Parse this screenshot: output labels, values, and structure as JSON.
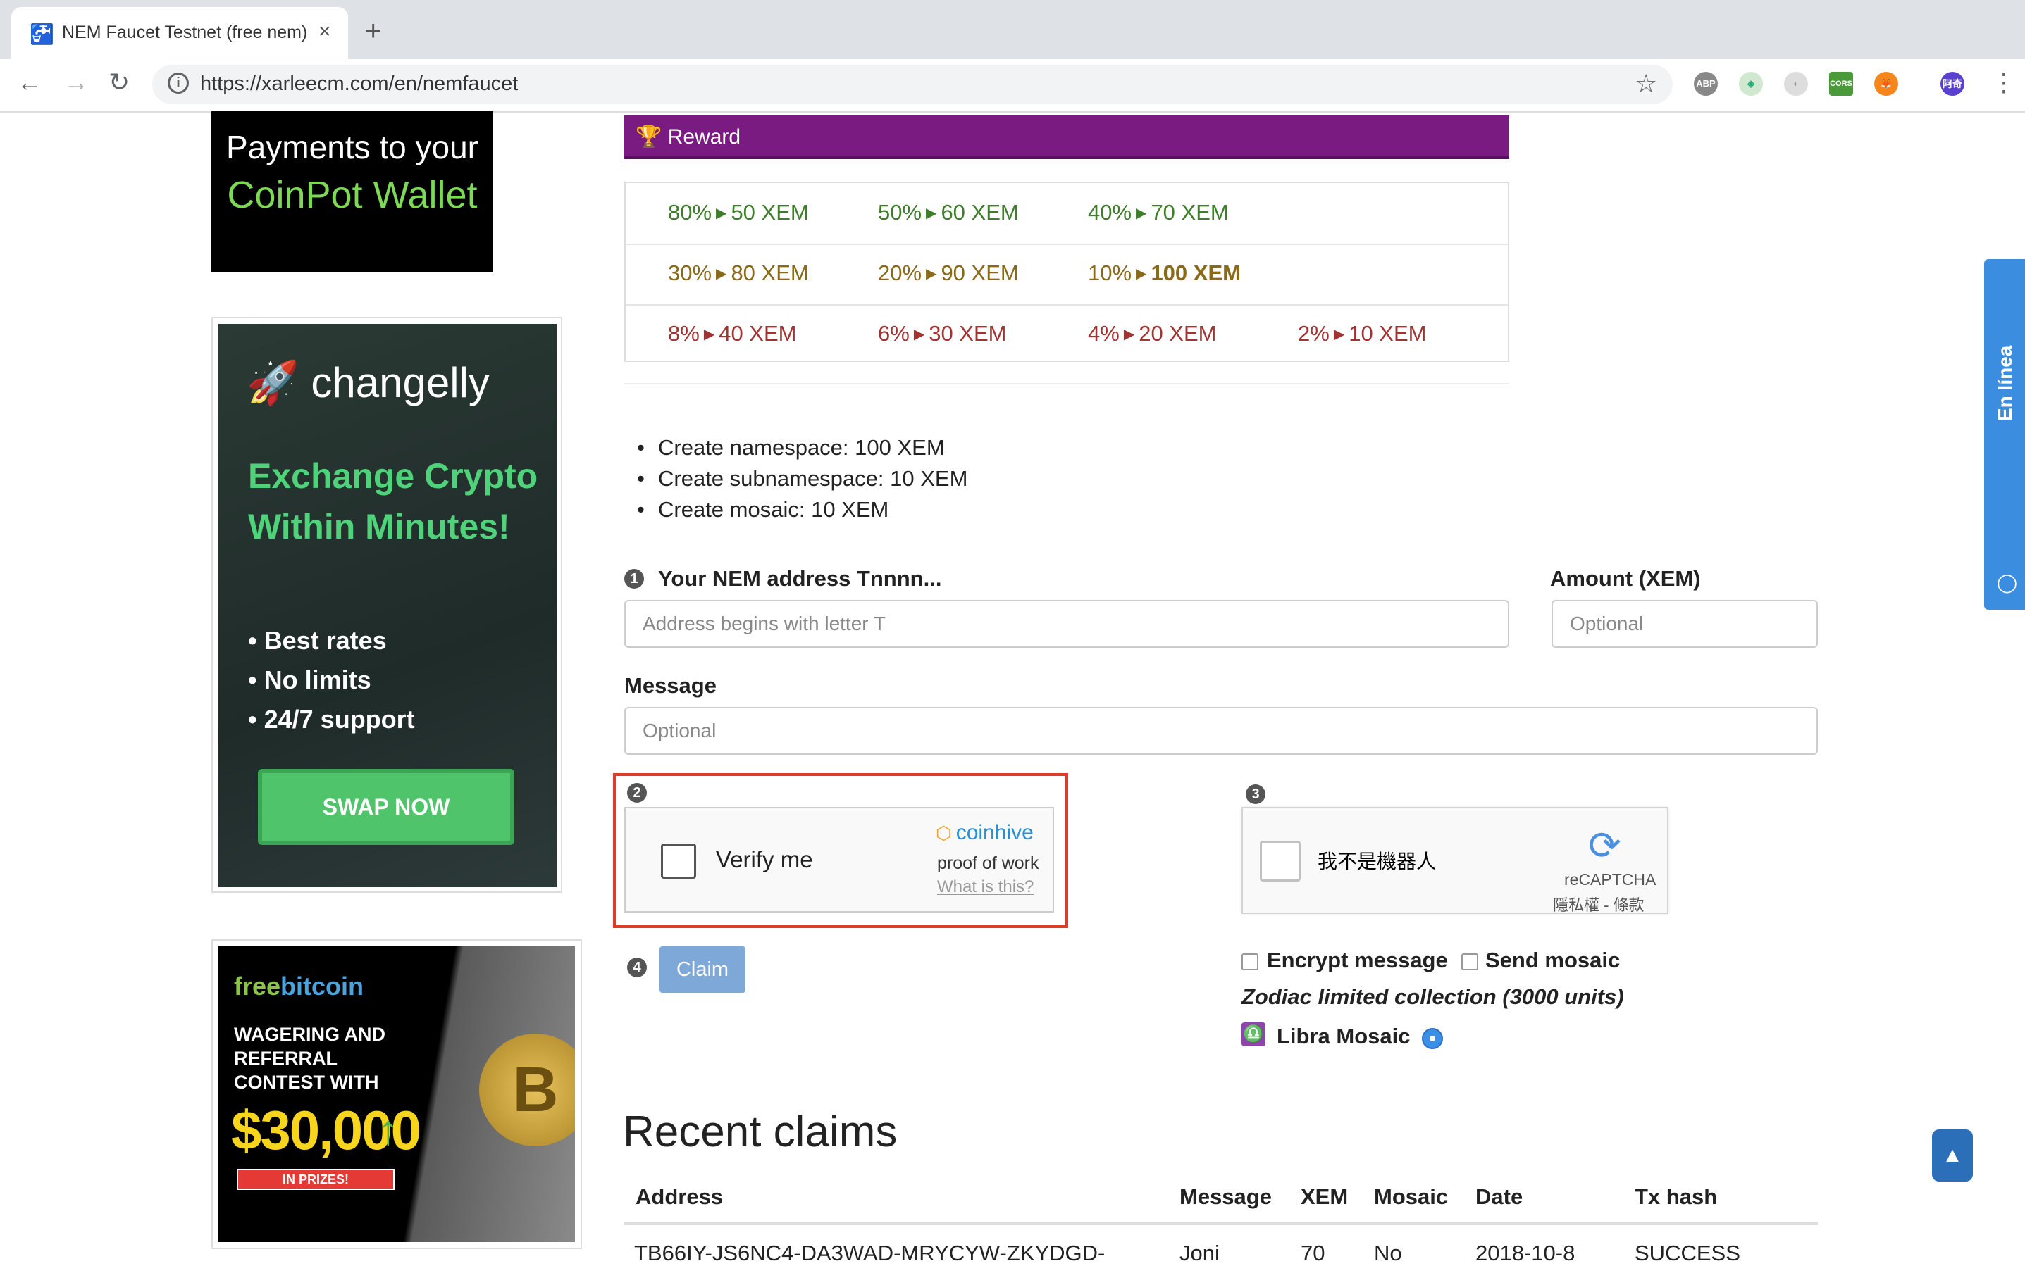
{
  "browser": {
    "tab_title": "NEM Faucet Testnet (free nem)",
    "tab_close": "×",
    "new_tab": "+",
    "url": "https://xarleecm.com/en/nemfaucet",
    "extensions": [
      "ABP",
      "CORS"
    ],
    "profile": "阿奇"
  },
  "ads": {
    "coinpot": {
      "line1": "Payments to your",
      "line2": "CoinPot Wallet"
    },
    "changelly": {
      "brand": "changelly",
      "headline": "Exchange Crypto Within Minutes!",
      "bullets": [
        "Best rates",
        "No limits",
        "24/7 support"
      ],
      "cta": "SWAP NOW"
    },
    "freebitcoin": {
      "brand_a": "free",
      "brand_b": "bitcoin",
      "text": "WAGERING AND REFERRAL CONTEST WITH",
      "amount": "$30,000",
      "prize": "IN PRIZES!",
      "coin_symbol": "B"
    }
  },
  "reward": {
    "title": "Reward",
    "rows": [
      [
        {
          "pct": "80%",
          "amt": "50 XEM"
        },
        {
          "pct": "50%",
          "amt": "60 XEM"
        },
        {
          "pct": "40%",
          "amt": "70 XEM"
        }
      ],
      [
        {
          "pct": "30%",
          "amt": "80 XEM"
        },
        {
          "pct": "20%",
          "amt": "90 XEM"
        },
        {
          "pct": "10%",
          "amt": "100 XEM"
        }
      ],
      [
        {
          "pct": "8%",
          "amt": "40 XEM"
        },
        {
          "pct": "6%",
          "amt": "30 XEM"
        },
        {
          "pct": "4%",
          "amt": "20 XEM"
        },
        {
          "pct": "2%",
          "amt": "10 XEM"
        }
      ]
    ],
    "colors": {
      "green": "#3d7d2b",
      "olive": "#8a6a1a",
      "red": "#a33232",
      "header": "#7a1b82"
    }
  },
  "operations": [
    "Create namespace: 100 XEM",
    "Create subnamespace: 10 XEM",
    "Create mosaic: 10 XEM"
  ],
  "form": {
    "step1": "1",
    "address_label": "Your NEM address Tnnnn...",
    "address_placeholder": "Address begins with letter T",
    "amount_label": "Amount (XEM)",
    "amount_placeholder": "Optional",
    "message_label": "Message",
    "message_placeholder": "Optional",
    "step2": "2",
    "step3": "3",
    "step4": "4",
    "coinhive": {
      "label": "Verify me",
      "brand": "coinhive",
      "pow": "proof of work",
      "what": "What is this?"
    },
    "recaptcha": {
      "label": "我不是機器人",
      "brand": "reCAPTCHA",
      "terms": "隱私權 - 條款"
    },
    "claim": "Claim",
    "encrypt": "Encrypt message",
    "send_mosaic": "Send mosaic",
    "zodiac": "Zodiac limited collection (3000 units)",
    "mosaic": "Libra Mosaic"
  },
  "recent": {
    "title": "Recent claims",
    "headers": [
      "Address",
      "Message",
      "XEM",
      "Mosaic",
      "Date",
      "Tx hash"
    ],
    "rows": [
      [
        "TB66IY-JS6NC4-DA3WAD-MRYCYW-ZKYDGD-",
        "Joni",
        "70",
        "No",
        "2018-10-8",
        "SUCCESS"
      ]
    ]
  },
  "widgets": {
    "chat": "En línea",
    "to_top": "▲"
  }
}
